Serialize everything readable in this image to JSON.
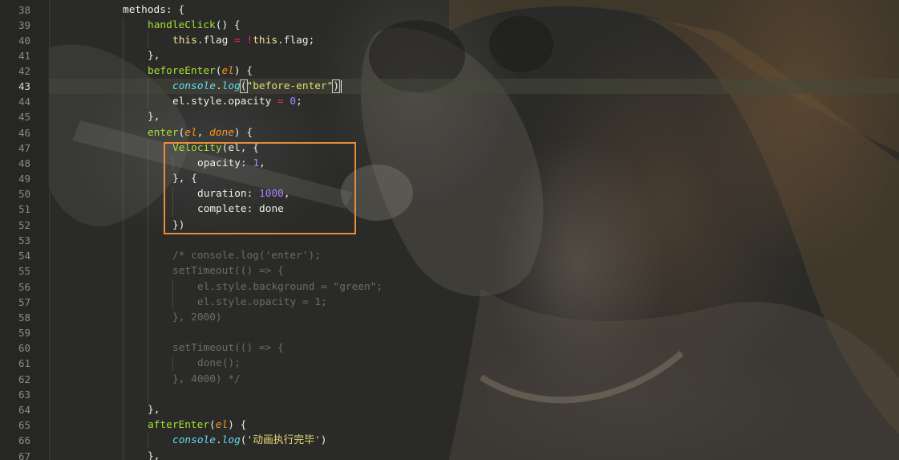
{
  "editor": {
    "theme_colors": {
      "keyword": "#f9e29a",
      "function": "#a6e22e",
      "builtin": "#66d9ef",
      "param": "#fd971f",
      "string": "#e6db74",
      "number": "#ae81ff",
      "operator": "#f92672",
      "highlight_box": "#e98b38"
    },
    "background": "photo-of-singer-with-microphone",
    "active_line": 43,
    "line_numbers": [
      "38",
      "39",
      "40",
      "41",
      "42",
      "43",
      "44",
      "45",
      "46",
      "47",
      "48",
      "49",
      "50",
      "51",
      "52",
      "53",
      "54",
      "55",
      "56",
      "57",
      "58",
      "59",
      "60",
      "61",
      "62",
      "63",
      "64",
      "65",
      "66",
      "67"
    ],
    "code": {
      "l38": {
        "a": "methods: {"
      },
      "l39": {
        "a": "handleClick",
        "b": "() {"
      },
      "l40": {
        "a": "this",
        "b": ".flag ",
        "c": "=",
        "d": " ",
        "e": "!",
        "f": "this",
        "g": ".flag;"
      },
      "l41": {
        "a": "},"
      },
      "l42": {
        "a": "beforeEnter",
        "b": "(",
        "c": "el",
        "d": ") {"
      },
      "l43": {
        "a": "console",
        "b": ".",
        "c": "log",
        "d": "(",
        "e": "\"before-enter\"",
        "f": ")"
      },
      "l44": {
        "a": "el.style.opacity ",
        "b": "=",
        "c": " ",
        "d": "0",
        "e": ";"
      },
      "l45": {
        "a": "},"
      },
      "l46": {
        "a": "enter",
        "b": "(",
        "c": "el",
        "d": ", ",
        "e": "done",
        "f": ") {"
      },
      "l47": {
        "a": "Velocity",
        "b": "(el, {"
      },
      "l48": {
        "a": "opacity: ",
        "b": "1",
        "c": ","
      },
      "l49": {
        "a": "}, {"
      },
      "l50": {
        "a": "duration: ",
        "b": "1000",
        "c": ","
      },
      "l51": {
        "a": "complete: done"
      },
      "l52": {
        "a": "})"
      },
      "l54": {
        "a": "/* console.log('enter');"
      },
      "l55": {
        "a": "setTimeout(() => {"
      },
      "l56": {
        "a": "el.style.background = \"green\";"
      },
      "l57": {
        "a": "el.style.opacity = 1;"
      },
      "l58": {
        "a": "}, 2000)"
      },
      "l60": {
        "a": "setTimeout(() => {"
      },
      "l61": {
        "a": "done();"
      },
      "l62": {
        "a": "}, 4000) */"
      },
      "l64": {
        "a": "},"
      },
      "l65": {
        "a": "afterEnter",
        "b": "(",
        "c": "el",
        "d": ") {"
      },
      "l66": {
        "a": "console",
        "b": ".",
        "c": "log",
        "d": "(",
        "e": "'动画执行完毕'",
        "f": ")"
      },
      "l67": {
        "a": "},"
      }
    }
  }
}
